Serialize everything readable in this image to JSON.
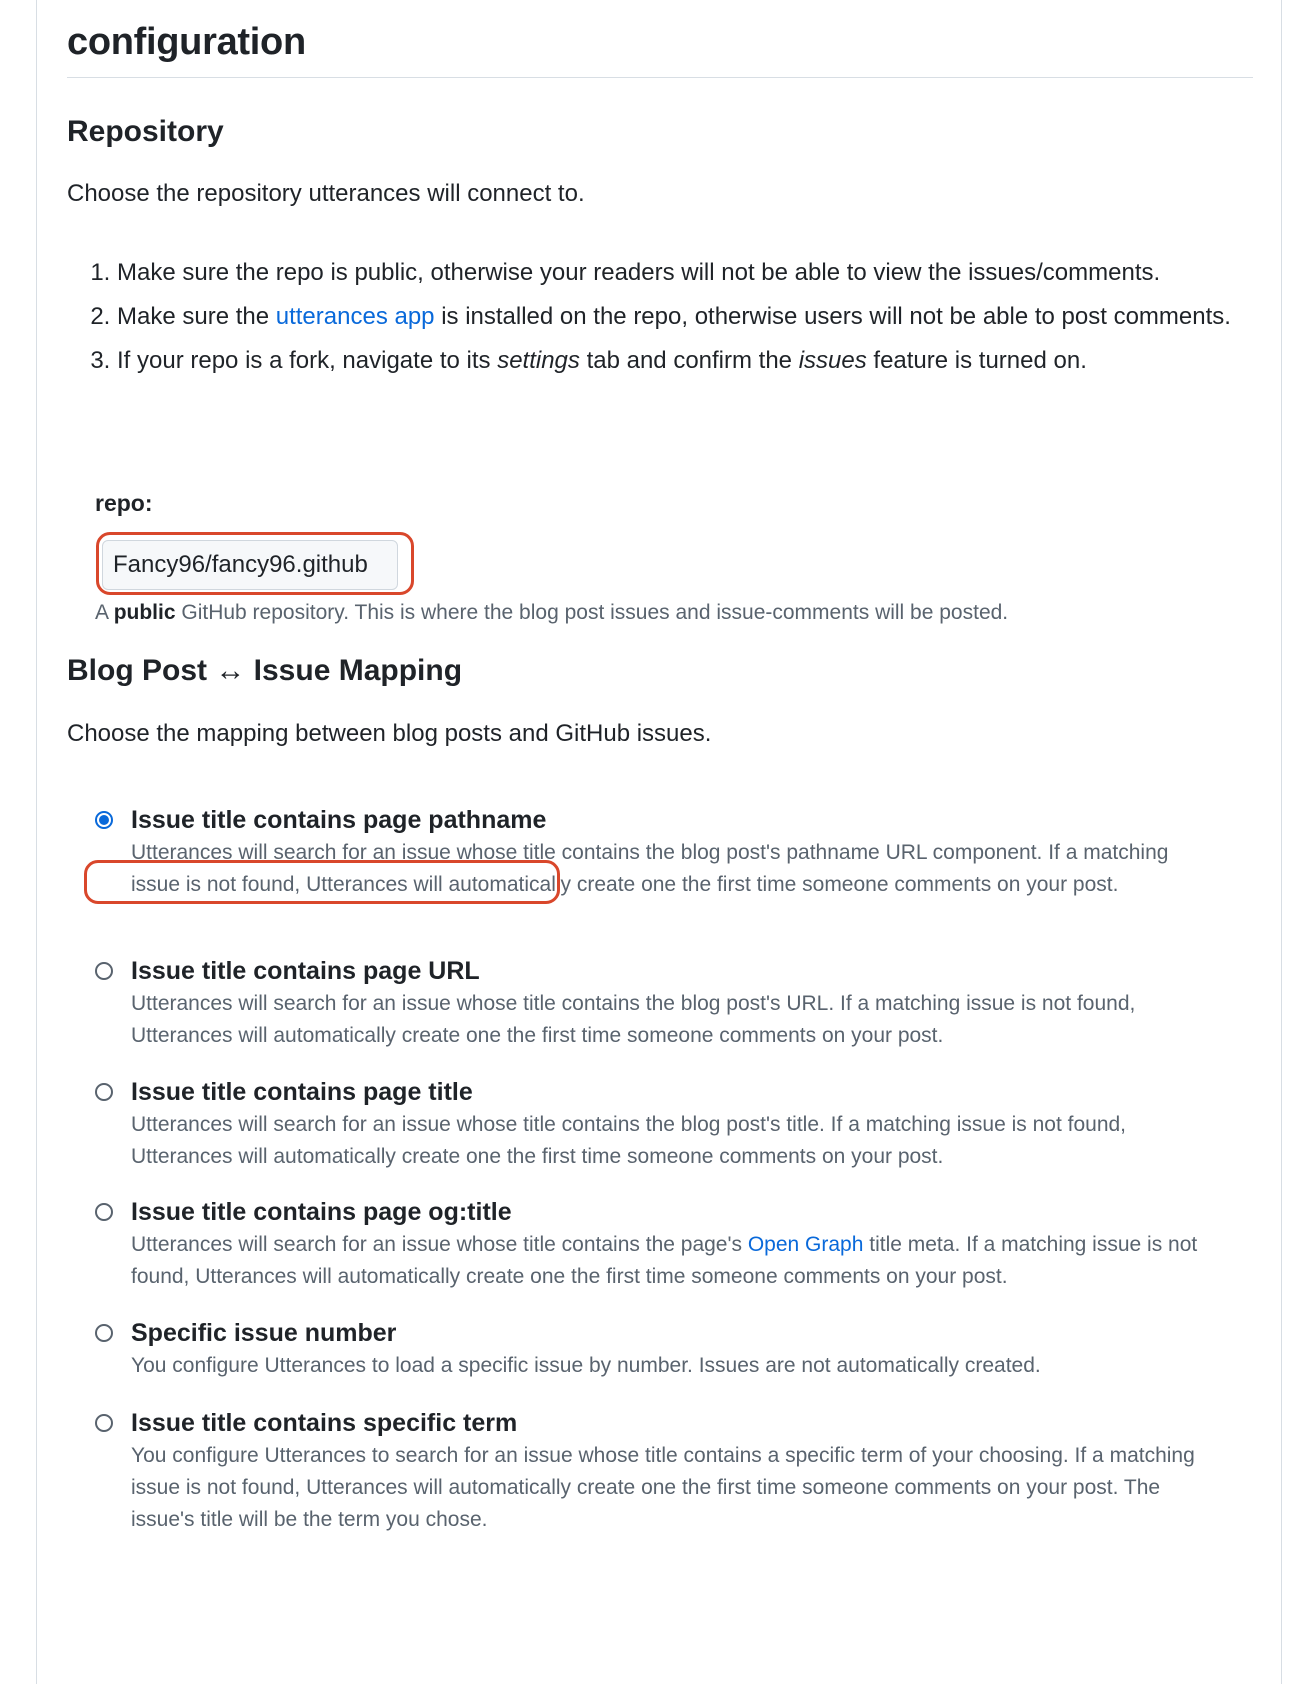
{
  "title": "configuration",
  "repository": {
    "heading": "Repository",
    "intro": "Choose the repository utterances will connect to.",
    "steps": {
      "s1": "Make sure the repo is public, otherwise your readers will not be able to view the issues/comments.",
      "s2_pre": "Make sure the ",
      "s2_link": "utterances app",
      "s2_post": " is installed on the repo, otherwise users will not be able to post comments.",
      "s3_pre": "If your repo is a fork, navigate to its ",
      "s3_em1": "settings",
      "s3_mid": " tab and confirm the ",
      "s3_em2": "issues",
      "s3_post": " feature is turned on."
    },
    "repo_label": "repo:",
    "repo_value": "Fancy96/fancy96.github",
    "note_pre": "A ",
    "note_bold": "public",
    "note_post": " GitHub repository. This is where the blog post issues and issue-comments will be posted."
  },
  "mapping": {
    "heading": "Blog Post ↔ Issue Mapping",
    "intro": "Choose the mapping between blog posts and GitHub issues.",
    "options": [
      {
        "title": "Issue title contains page pathname",
        "desc": "Utterances will search for an issue whose title contains the blog post's pathname URL component. If a matching issue is not found, Utterances will automatically create one the first time someone comments on your post.",
        "checked": true
      },
      {
        "title": "Issue title contains page URL",
        "desc": "Utterances will search for an issue whose title contains the blog post's URL. If a matching issue is not found, Utterances will automatically create one the first time someone comments on your post.",
        "checked": false
      },
      {
        "title": "Issue title contains page title",
        "desc": "Utterances will search for an issue whose title contains the blog post's title. If a matching issue is not found, Utterances will automatically create one the first time someone comments on your post.",
        "checked": false
      },
      {
        "title": "Issue title contains page og:title",
        "desc_pre": "Utterances will search for an issue whose title contains the page's ",
        "desc_link": "Open Graph",
        "desc_post": " title meta. If a matching issue is not found, Utterances will automatically create one the first time someone comments on your post.",
        "checked": false
      },
      {
        "title": "Specific issue number",
        "desc": "You configure Utterances to load a specific issue by number. Issues are not automatically created.",
        "checked": false
      },
      {
        "title": "Issue title contains specific term",
        "desc": "You configure Utterances to search for an issue whose title contains a specific term of your choosing. If a matching issue is not found, Utterances will automatically create one the first time someone comments on your post. The issue's title will be the term you chose.",
        "checked": false
      }
    ]
  },
  "colors": {
    "link": "#0969da",
    "highlight": "#d9472b",
    "muted": "#59636e"
  }
}
